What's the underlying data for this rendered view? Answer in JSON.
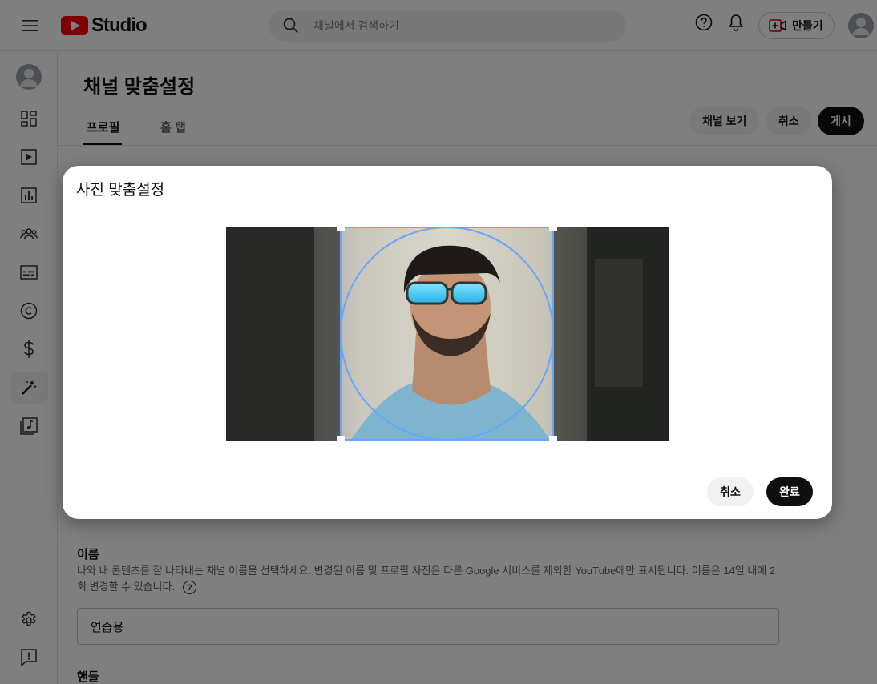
{
  "header": {
    "logo_text": "Studio",
    "search_placeholder": "채널에서 검색하기",
    "create_label": "만들기"
  },
  "page": {
    "title": "채널 맞춤설정",
    "tabs": [
      {
        "label": "프로필",
        "active": true
      },
      {
        "label": "홈 탭",
        "active": false
      }
    ],
    "actions": {
      "view_channel": "채널 보기",
      "cancel": "취소",
      "publish": "게시"
    }
  },
  "name_section": {
    "label": "이름",
    "description": "나와 내 콘텐츠를 잘 나타내는 채널 이름을 선택하세요. 변경된 이름 및 프로필 사진은 다른 Google 서비스를 제외한 YouTube에만 표시됩니다. 이름은 14일 내에 2회 변경할 수 있습니다.",
    "value": "연습용"
  },
  "handle_section": {
    "label": "핸들"
  },
  "dialog": {
    "title": "사진 맞춤설정",
    "cancel_label": "취소",
    "done_label": "완료"
  },
  "icons": {
    "menu": "hamburger-menu-icon",
    "search": "search-icon",
    "help": "help-circle-icon",
    "notifications": "bell-icon",
    "create": "video-plus-icon",
    "sidebar": [
      "dashboard-icon",
      "content-icon",
      "analytics-icon",
      "community-icon",
      "subtitles-icon",
      "copyright-icon",
      "monetization-icon",
      "customization-icon",
      "audio-library-icon",
      "settings-icon",
      "feedback-icon"
    ]
  },
  "colors": {
    "brand_red": "#ff0000",
    "crop_accent": "#65a6ff",
    "primary_dark": "#0f0f0f"
  }
}
